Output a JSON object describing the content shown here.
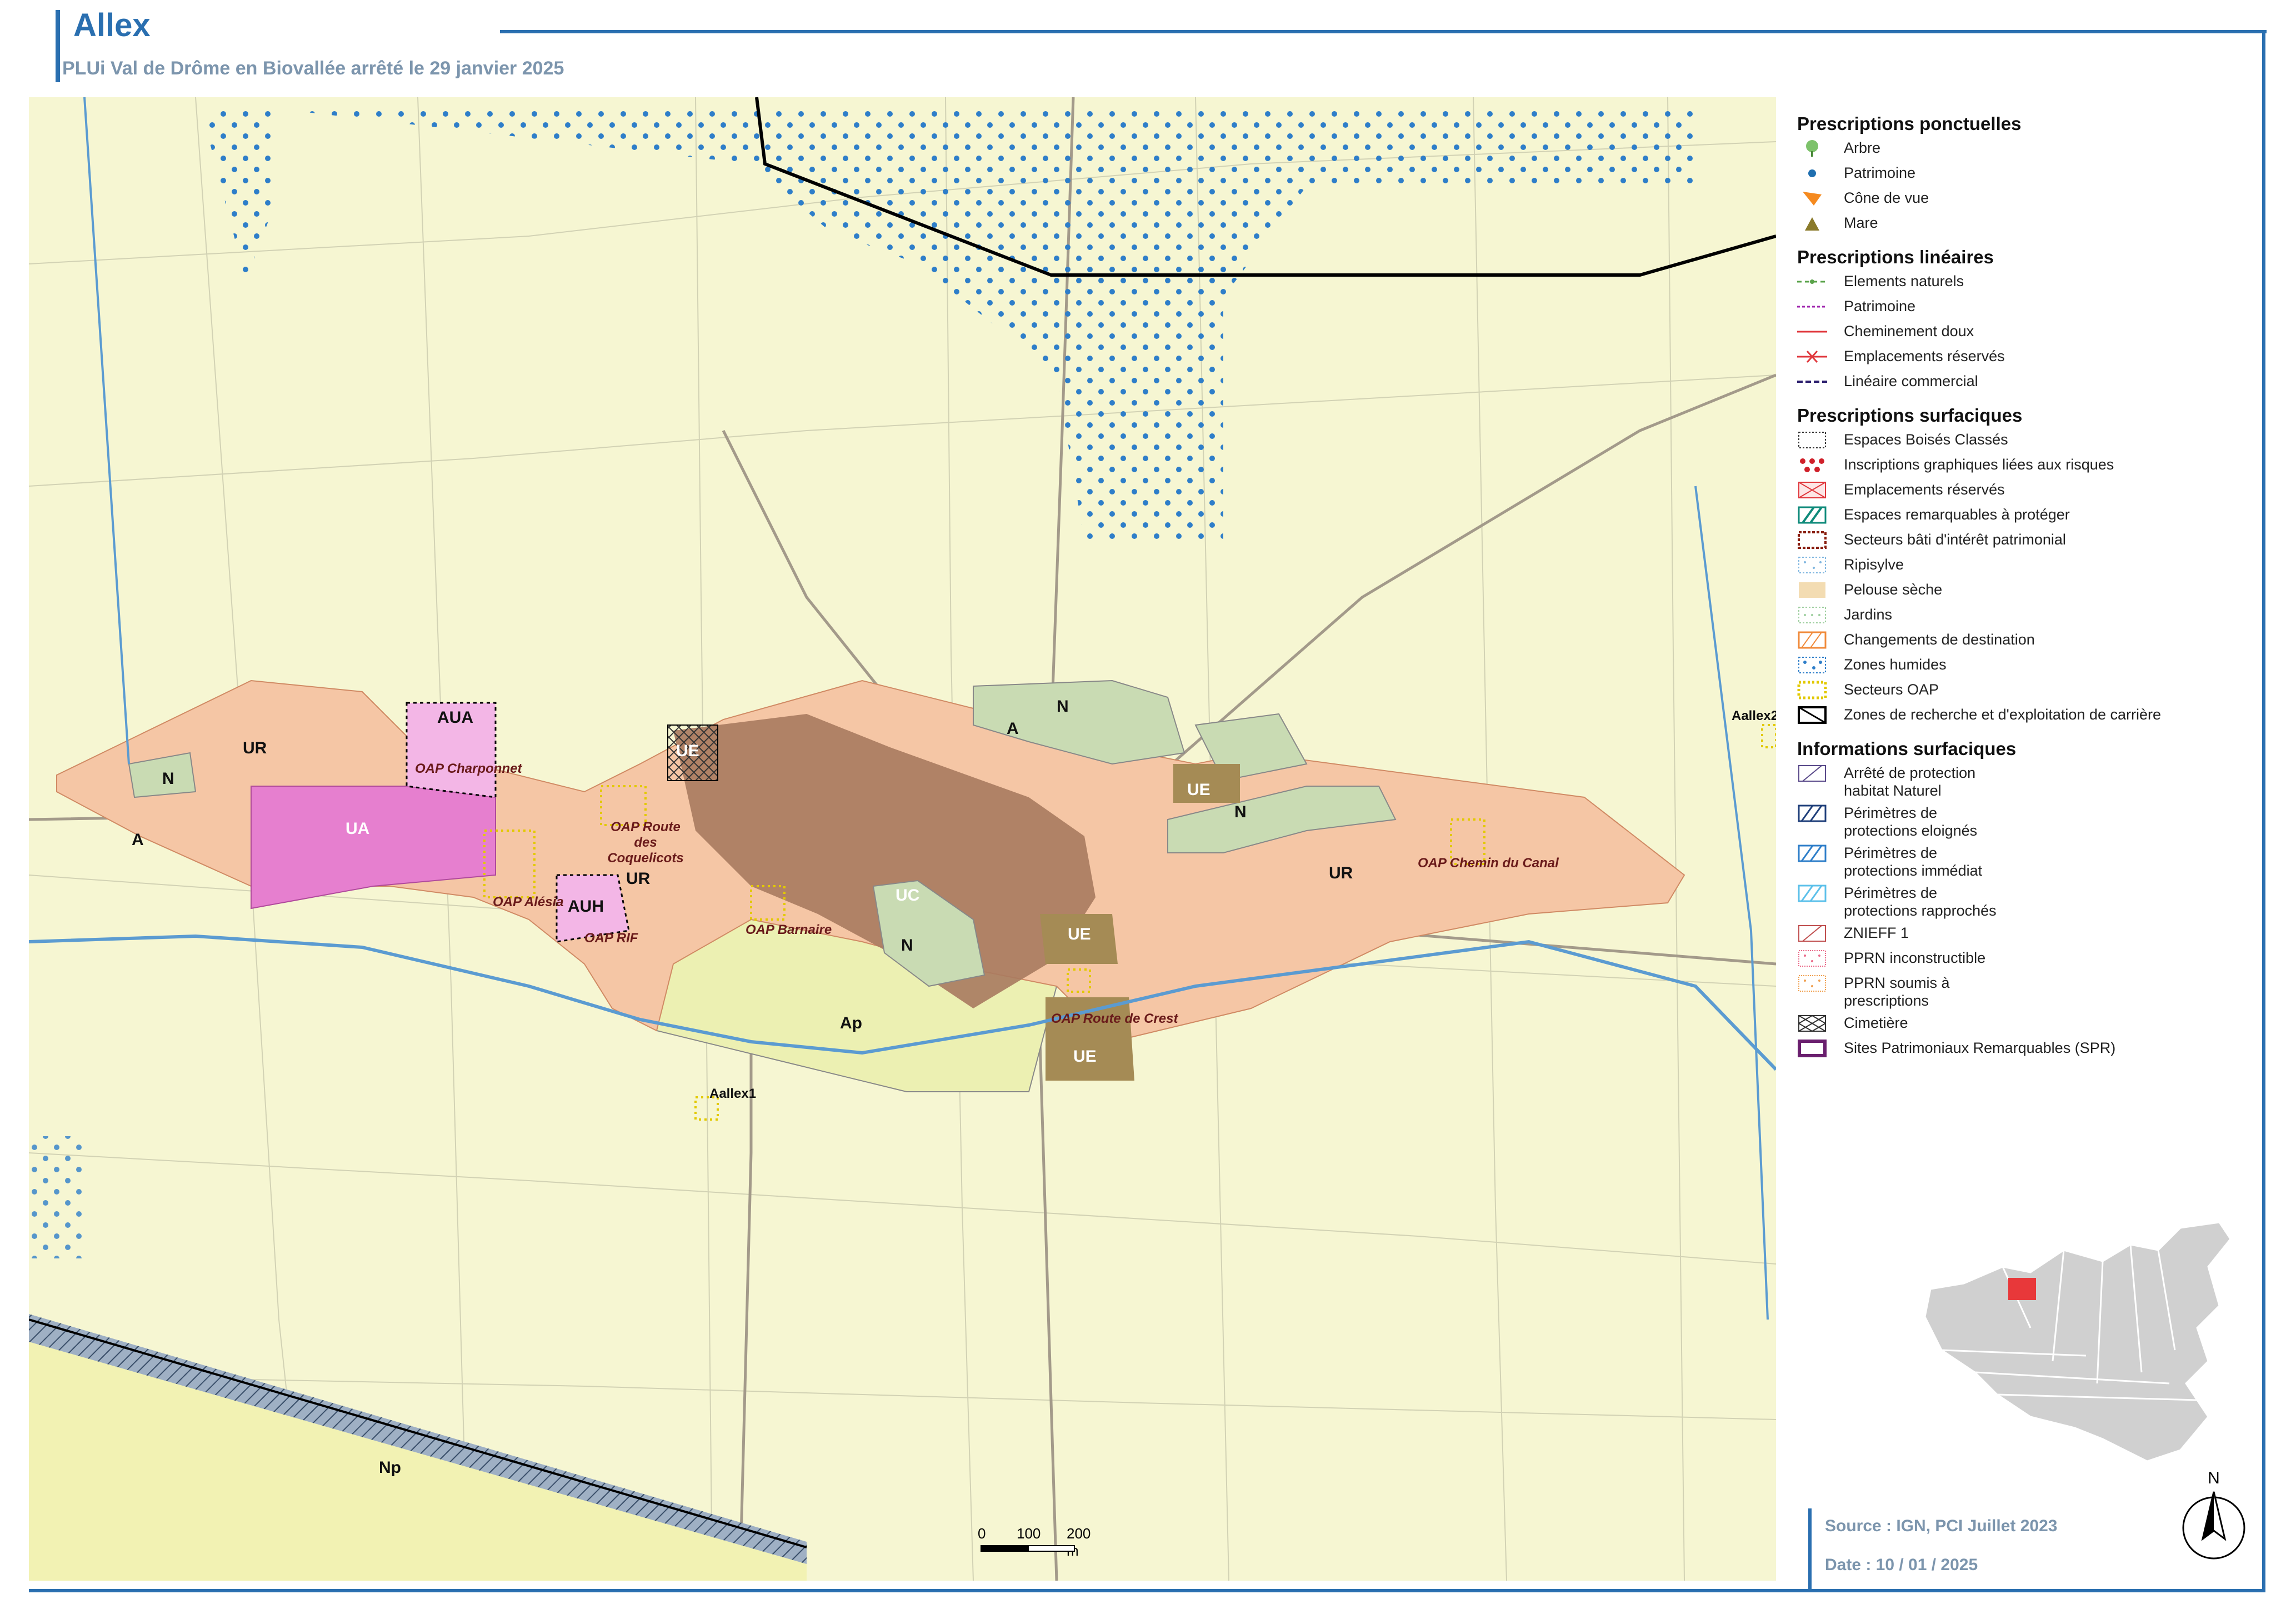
{
  "header": {
    "title": "Allex",
    "subtitle": "PLUi Val de Drôme en Biovallée arrêté le 29 janvier 2025"
  },
  "colors": {
    "frame": "#2a6fb0",
    "map_background": "#f6f6d2",
    "zone_UR": "#f5c6a5",
    "zone_UC": "#a87a5f",
    "zone_UE": "#a58b55",
    "zone_UA": "#e67fcf",
    "zone_AU": "#f3b6e6",
    "zone_N": "#c9dbb3",
    "zone_Ap": "#ecf0b2",
    "zones_humides_dots": "#2e7ec9",
    "quarry_line": "#000000"
  },
  "map": {
    "zone_labels": [
      "A",
      "N",
      "UR",
      "AUA",
      "UA",
      "UE",
      "UR",
      "AUH",
      "UC",
      "N",
      "UE",
      "Ap",
      "UE",
      "A",
      "N",
      "UE",
      "N",
      "UR",
      "Np",
      "A"
    ],
    "oap_labels": [
      "OAP Charponnet",
      "OAP Route des Coquelicots",
      "OAP Alésia",
      "OAP RIF",
      "OAP Barnaire",
      "OAP Route de Crest",
      "OAP Chemin du Canal"
    ],
    "site_labels": [
      "Aallex1",
      "Aallex2"
    ],
    "scale": {
      "label_0": "0",
      "label_100": "100",
      "label_200": "200 m"
    }
  },
  "legend": {
    "sections": [
      {
        "title": "Prescriptions ponctuelles",
        "items": [
          {
            "label": "Arbre",
            "icon": "tree-icon"
          },
          {
            "label": "Patrimoine",
            "icon": "dot-icon"
          },
          {
            "label": "Cône de vue",
            "icon": "view-cone-icon"
          },
          {
            "label": "Mare",
            "icon": "triangle-icon"
          }
        ]
      },
      {
        "title": "Prescriptions linéaires",
        "items": [
          {
            "label": "Elements naturels",
            "icon": "line-green-dots"
          },
          {
            "label": "Patrimoine",
            "icon": "line-purple-dashed"
          },
          {
            "label": "Cheminement doux",
            "icon": "line-red"
          },
          {
            "label": "Emplacements réservés",
            "icon": "line-red-x"
          },
          {
            "label": "Linéaire commercial",
            "icon": "line-navy-dashed"
          }
        ]
      },
      {
        "title": "Prescriptions surfaciques",
        "items": [
          {
            "label": "Espaces Boisés Classés",
            "icon": "box-ebc"
          },
          {
            "label": "Inscriptions graphiques liées aux risques",
            "icon": "box-red-dots"
          },
          {
            "label": "Emplacements réservés",
            "icon": "box-red-cross"
          },
          {
            "label": "Espaces remarquables à protéger",
            "icon": "box-teal-hatch"
          },
          {
            "label": "Secteurs bâti d'intérêt patrimonial",
            "icon": "box-brown-dashed"
          },
          {
            "label": "Ripisylve",
            "icon": "box-blue-dots"
          },
          {
            "label": "Pelouse sèche",
            "icon": "box-tan"
          },
          {
            "label": "Jardins",
            "icon": "box-green-dots"
          },
          {
            "label": "Changements de destination",
            "icon": "box-orange-hatch"
          },
          {
            "label": "Zones humides",
            "icon": "box-blue-bigdots"
          },
          {
            "label": "Secteurs OAP",
            "icon": "box-yellow-dotted"
          },
          {
            "label": "Zones de recherche et d'exploitation de carrière",
            "icon": "box-black"
          }
        ]
      },
      {
        "title": "Informations surfaciques",
        "items": [
          {
            "label": "Arrêté de protection habitat Naturel",
            "icon": "box-apb"
          },
          {
            "label": "Périmètres de protections eloignés",
            "icon": "box-navy-hatch"
          },
          {
            "label": "Périmètres de protections immédiat",
            "icon": "box-blue-hatch"
          },
          {
            "label": "Périmètres de protections rapprochés",
            "icon": "box-lightblue-hatch"
          },
          {
            "label": "ZNIEFF 1",
            "icon": "box-znieff"
          },
          {
            "label": "PPRN inconstructible",
            "icon": "box-pink-dots"
          },
          {
            "label": "PPRN soumis à prescriptions",
            "icon": "box-orange-dots"
          },
          {
            "label": "Cimetière",
            "icon": "box-crosshatch"
          },
          {
            "label": "Sites Patrimoniaux Remarquables (SPR)",
            "icon": "box-purple"
          }
        ]
      }
    ]
  },
  "footer": {
    "source": "Source : IGN, PCI Juillet 2023",
    "date": "Date : 10 / 01 / 2025",
    "north": "N"
  }
}
